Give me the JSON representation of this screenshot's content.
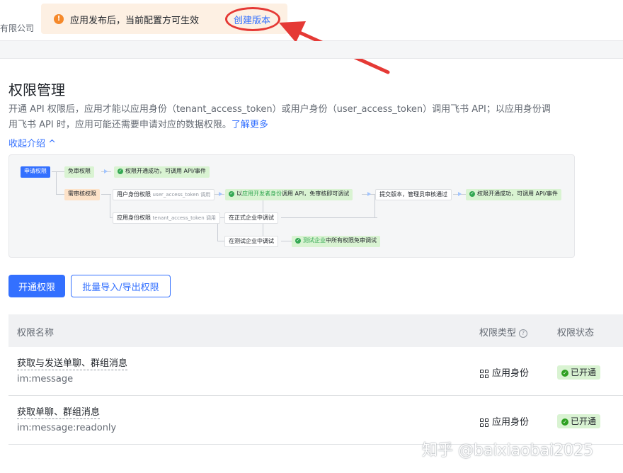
{
  "header": {
    "company_suffix": "有限公司",
    "notice_icon": "warning-icon",
    "notice_text": "应用发布后，当前配置方可生效",
    "notice_link": "创建版本"
  },
  "main": {
    "title": "权限管理",
    "desc_line1": "开通 API 权限后，应用才能以应用身份（tenant_access_token）或用户身份（user_access_token）调用飞书 API；以应用身份调",
    "desc_line2": "用飞书 API 时，应用可能还需要申请对应的数据权限。",
    "learn_more": "了解更多",
    "collapse": "收起介绍 ^"
  },
  "flow": {
    "apply": "申请权限",
    "no_review": "免审权限",
    "success1": "权限开通成功，可调用 API/事件",
    "need_review": "需审核权限",
    "user_perm": "用户身份权限",
    "user_token": "user_access_token 调用",
    "dev_prefix": "以",
    "dev_hl": "应用开发者身份",
    "dev_suffix": "调用 API，免审核即可调试",
    "submit": "提交版本，管理员审核通过",
    "success2": "权限开通成功，可调用 API/事件",
    "app_perm": "应用身份权限",
    "tenant_token": "tenant_access_token 调用",
    "prod_debug": "在正式企业中调试",
    "test_debug": "在测试企业中调试",
    "test_hl": "测试企业",
    "test_suffix": "中所有权限免审调试"
  },
  "buttons": {
    "enable": "开通权限",
    "bulk": "批量导入/导出权限"
  },
  "table": {
    "headers": {
      "name": "权限名称",
      "type": "权限类型",
      "status": "权限状态"
    },
    "rows": [
      {
        "name": "获取与发送单聊、群组消息",
        "code": "im:message",
        "type": "应用身份",
        "status": "已开通"
      },
      {
        "name": "获取单聊、群组消息",
        "code": "im:message:readonly",
        "type": "应用身份",
        "status": "已开通"
      }
    ]
  },
  "watermark": "知乎 @baixiaobai2025",
  "colors": {
    "accent": "#3370ff",
    "annotation": "#e53935",
    "success": "#2ea121",
    "warning": "#f5892a"
  }
}
